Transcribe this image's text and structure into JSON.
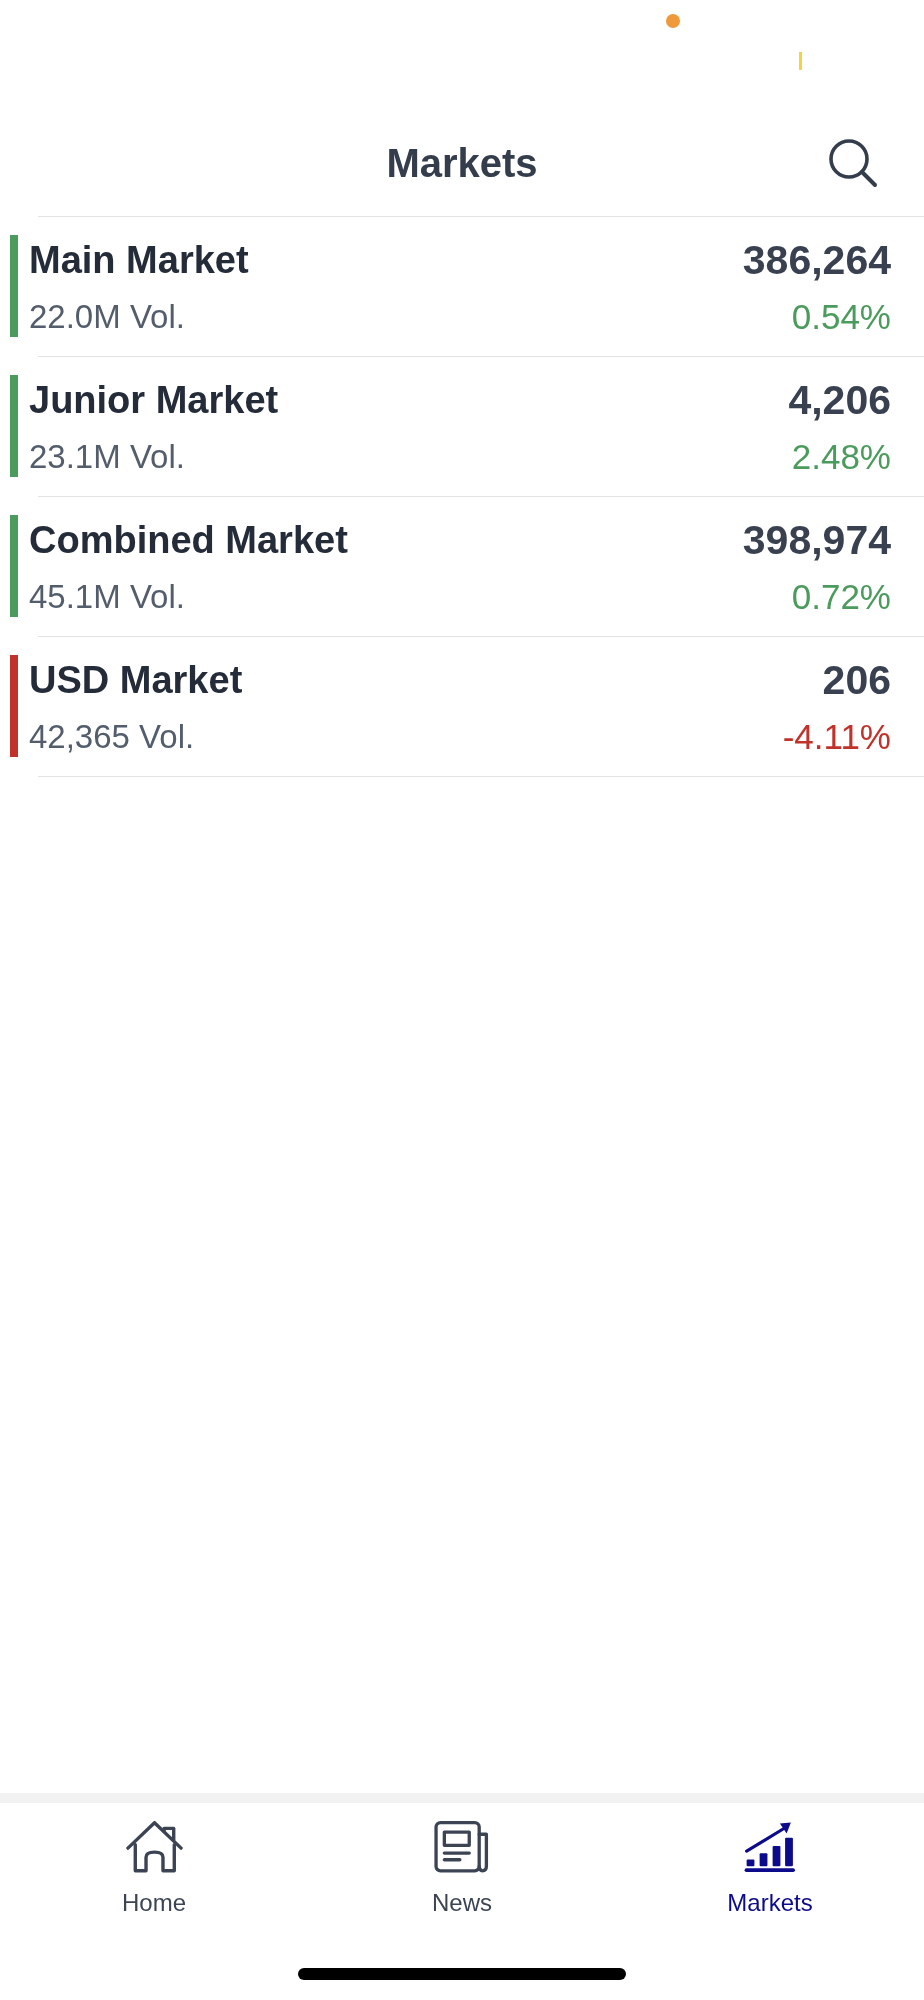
{
  "header": {
    "title": "Markets"
  },
  "markets": [
    {
      "name": "Main Market",
      "volume": "22.0M Vol.",
      "value": "386,264",
      "change": "0.54%",
      "color": "#4a9b5c"
    },
    {
      "name": "Junior Market",
      "volume": "23.1M Vol.",
      "value": "4,206",
      "change": "2.48%",
      "color": "#4a9b5c"
    },
    {
      "name": "Combined Market",
      "volume": "45.1M Vol.",
      "value": "398,974",
      "change": "0.72%",
      "color": "#4a9b5c"
    },
    {
      "name": "USD Market",
      "volume": "42,365 Vol.",
      "value": "206",
      "change": "-4.11%",
      "color": "#c0322a"
    }
  ],
  "tab_bar": [
    {
      "label": "Home",
      "selected": false
    },
    {
      "label": "News",
      "selected": false
    },
    {
      "label": "Markets",
      "selected": true
    }
  ]
}
